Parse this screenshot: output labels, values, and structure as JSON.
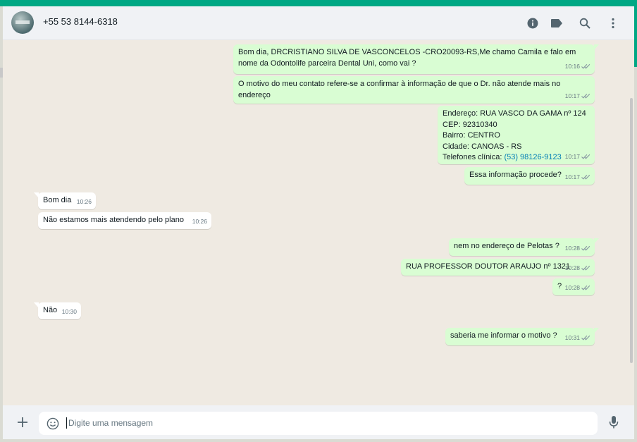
{
  "header": {
    "contact_name": "+55 53 8144-6318"
  },
  "messages": [
    {
      "text": "Bom dia, DRCRISTIANO SILVA DE VASCONCELOS -CRO20093-RS,Me chamo Camila e falo em nome da Odontolife parceira Dental Uni, como vai ?",
      "time": "10:16"
    },
    {
      "text": "O motivo do meu contato refere-se a confirmar à informação de que o Dr. não atende mais no endereço",
      "time": "10:17"
    },
    {
      "lines": [
        "Endereço: RUA VASCO DA GAMA nº 124",
        "CEP: 92310340",
        "Bairro: CENTRO",
        "Cidade: CANOAS - RS"
      ],
      "phone_label": "Telefones clínica: ",
      "phone_link": "(53) 98126-9123",
      "time": "10:17"
    },
    {
      "text": "Essa informação procede?",
      "time": "10:17"
    },
    {
      "text": "Bom dia",
      "time": "10:26"
    },
    {
      "text": "Não estamos mais atendendo pelo plano",
      "time": "10:26"
    },
    {
      "text": "nem no endereço de Pelotas ?",
      "time": "10:28"
    },
    {
      "text": "RUA PROFESSOR DOUTOR ARAUJO nº 1321",
      "time": "10:28"
    },
    {
      "text": "?",
      "time": "10:28"
    },
    {
      "text": "Não",
      "time": "10:30"
    },
    {
      "text": "saberia me informar o motivo ?",
      "time": "10:31"
    }
  ],
  "composer": {
    "placeholder": "Digite uma mensagem"
  },
  "icons": {
    "info": "info-icon",
    "label": "label-icon",
    "search": "search-icon",
    "menu": "menu-icon",
    "attach": "plus-icon",
    "emoji": "emoji-icon",
    "mic": "mic-icon"
  },
  "colors": {
    "accent": "#00a884",
    "outgoing_bubble": "#d9fdd3",
    "incoming_bubble": "#ffffff",
    "read_tick": "#8696a0",
    "link": "#027eb5"
  }
}
